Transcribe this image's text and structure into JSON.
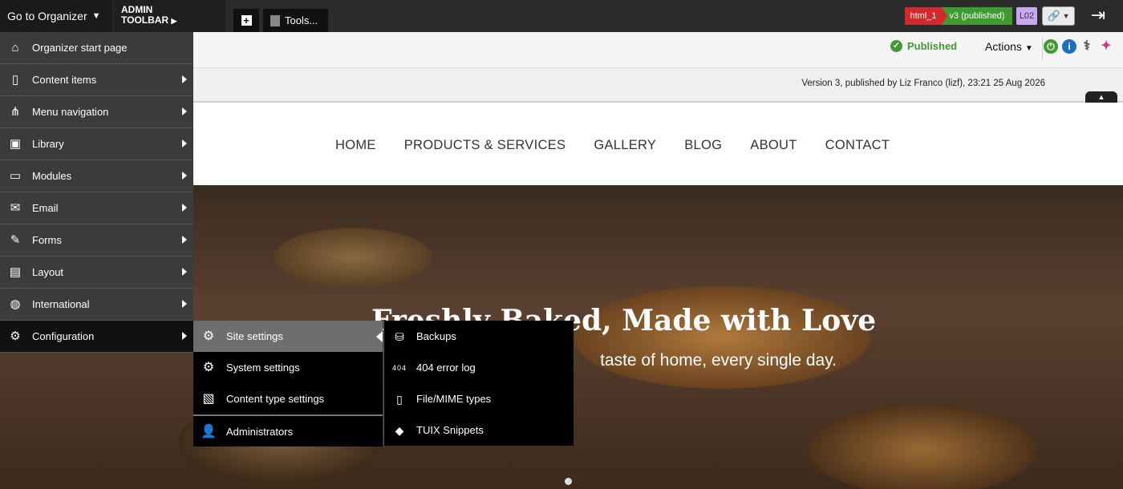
{
  "topbar": {
    "goto_label": "Go to Organizer",
    "admin_toolbar_line1": "ADMIN",
    "admin_toolbar_line2": "TOOLBAR",
    "tools_label": "Tools...",
    "tag_html": "html_1",
    "tag_version": "v3 (published)",
    "tag_layout": "L02"
  },
  "subbar": {
    "status": "Published",
    "actions_label": "Actions"
  },
  "version_info": "Version 3, published by Liz Franco (lizf), 23:21 25 Aug 2026",
  "site": {
    "nav": [
      "HOME",
      "PRODUCTS & SERVICES",
      "GALLERY",
      "BLOG",
      "ABOUT",
      "CONTACT"
    ],
    "hero_title": "Freshly Baked, Made with Love",
    "hero_subtitle": "taste of home, every single day."
  },
  "organizer_menu": {
    "items": [
      {
        "label": "Organizer start page",
        "icon": "home-icon"
      },
      {
        "label": "Content items",
        "icon": "document-icon"
      },
      {
        "label": "Menu navigation",
        "icon": "sitemap-icon"
      },
      {
        "label": "Library",
        "icon": "images-icon"
      },
      {
        "label": "Modules",
        "icon": "calendar-icon"
      },
      {
        "label": "Email",
        "icon": "envelope-icon"
      },
      {
        "label": "Forms",
        "icon": "form-icon"
      },
      {
        "label": "Layout",
        "icon": "layout-icon"
      },
      {
        "label": "International",
        "icon": "globe-icon"
      },
      {
        "label": "Configuration",
        "icon": "gears-icon"
      }
    ]
  },
  "config_menu": {
    "items": [
      {
        "label": "Site settings",
        "icon": "gears-icon"
      },
      {
        "label": "System settings",
        "icon": "gears-icon"
      },
      {
        "label": "Content type settings",
        "icon": "document-gear-icon"
      },
      {
        "label": "Administrators",
        "icon": "user-icon"
      }
    ]
  },
  "site_settings_menu": {
    "items": [
      {
        "label": "Backups",
        "icon": "backup-icon"
      },
      {
        "label": "404 error log",
        "icon": "404-icon",
        "icon_text": "404"
      },
      {
        "label": "File/MIME types",
        "icon": "file-types-icon"
      },
      {
        "label": "TUIX Snippets",
        "icon": "tuix-icon"
      }
    ]
  }
}
